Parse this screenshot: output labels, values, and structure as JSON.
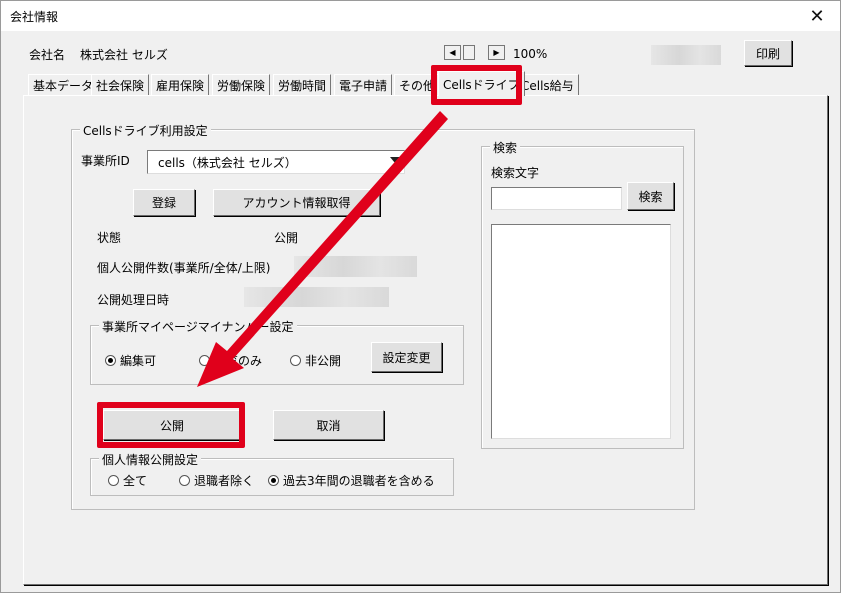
{
  "window": {
    "title": "会社情報",
    "close_symbol": "✕"
  },
  "header": {
    "company_label": "会社名",
    "company_name": "株式会社 セルズ",
    "zoom_prev_symbol": "◀",
    "zoom_next_symbol": "▶",
    "zoom_value": "100%",
    "print_label": "印刷"
  },
  "tabs": [
    {
      "label": "基本データ"
    },
    {
      "label": "社会保険"
    },
    {
      "label": "雇用保険"
    },
    {
      "label": "労働保険"
    },
    {
      "label": "労働時間"
    },
    {
      "label": "電子申請"
    },
    {
      "label": "その他"
    },
    {
      "label": "Cellsドライブ",
      "active": true
    },
    {
      "label": "Cells給与"
    }
  ],
  "cells_drive": {
    "group_label": "Cellsドライブ利用設定",
    "office_id_label": "事業所ID",
    "office_id_value": "cells（株式会社 セルズ）",
    "register_label": "登録",
    "account_info_label": "アカウント情報取得",
    "status_label": "状態",
    "status_value": "公開",
    "personal_count_label": "個人公開件数(事業所/全体/上限)",
    "publish_date_label": "公開処理日時",
    "mypage_group": {
      "label": "事業所マイページマイナンバー設定",
      "options": [
        "編集可",
        "閲覧のみ",
        "非公開"
      ],
      "selected": 0,
      "change_button": "設定変更"
    },
    "publish_button": "公開",
    "cancel_button": "取消",
    "personal_group": {
      "label": "個人情報公開設定",
      "options": [
        "全て",
        "退職者除く",
        "過去3年間の退職者を含める"
      ],
      "selected": 2
    }
  },
  "search": {
    "group_label": "検索",
    "text_label": "検索文字",
    "input_value": "",
    "button_label": "検索"
  },
  "annotation": {
    "color": "#e0001b"
  }
}
